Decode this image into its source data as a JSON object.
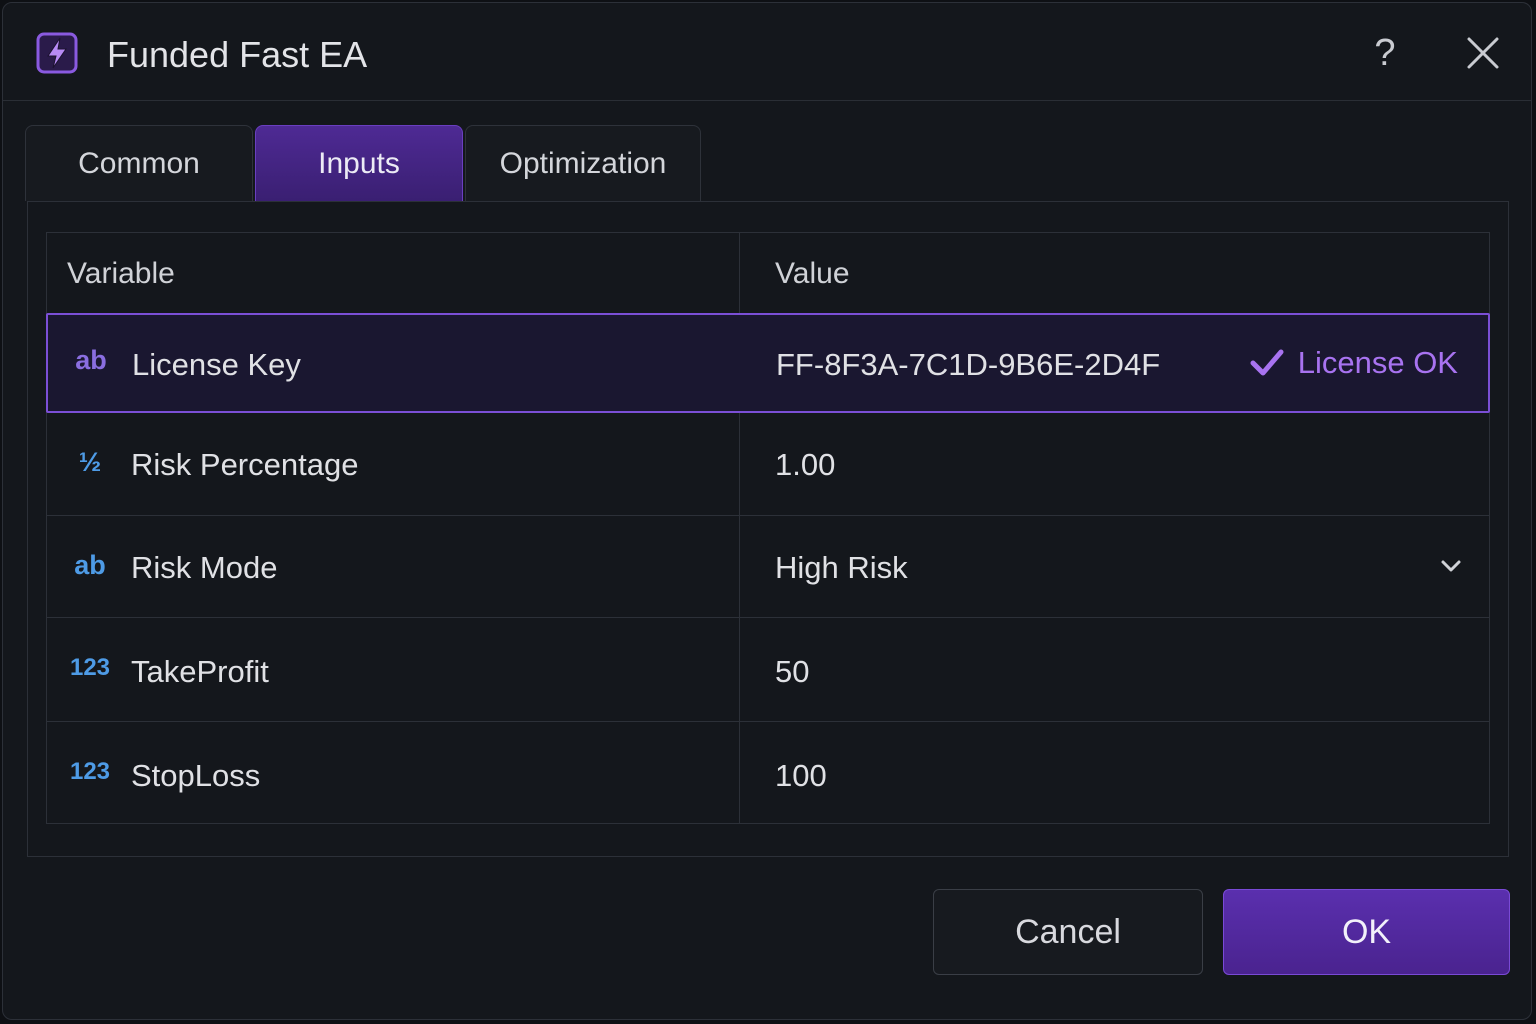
{
  "window": {
    "title": "Funded Fast EA",
    "help_label": "?"
  },
  "tabs": [
    {
      "label": "Common",
      "active": false
    },
    {
      "label": "Inputs",
      "active": true
    },
    {
      "label": "Optimization",
      "active": false
    }
  ],
  "table": {
    "headers": {
      "variable": "Variable",
      "value": "Value"
    },
    "rows": [
      {
        "type_label": "ab",
        "type_icon": "string-type-icon",
        "variable": "License Key",
        "value": "FF-8F3A-7C1D-9B6E-2D4F",
        "status": "License OK",
        "selected": true
      },
      {
        "type_label": "½",
        "type_icon": "double-type-icon",
        "variable": "Risk Percentage",
        "value": "1.00"
      },
      {
        "type_label": "ab",
        "type_icon": "enum-type-icon",
        "variable": "Risk Mode",
        "value": "High Risk",
        "dropdown": true
      },
      {
        "type_label": "123",
        "type_icon": "integer-type-icon",
        "variable": "TakeProfit",
        "value": "50"
      },
      {
        "type_label": "123",
        "type_icon": "integer-type-icon",
        "variable": "StopLoss",
        "value": "100"
      }
    ]
  },
  "buttons": {
    "cancel": "Cancel",
    "ok": "OK"
  },
  "colors": {
    "accent": "#6a3fc0",
    "accent_text": "#a873f0",
    "type_string": "#8a6ee0",
    "type_number": "#4e9be6",
    "background": "#14171c"
  }
}
